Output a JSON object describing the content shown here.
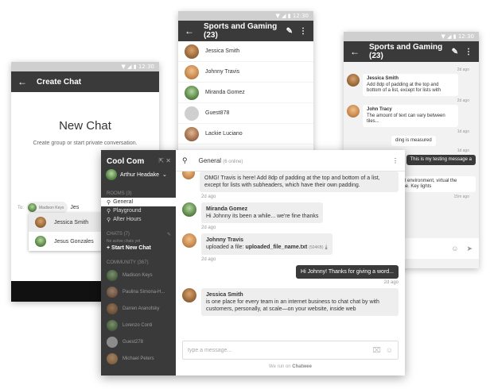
{
  "phone1": {
    "status_time": "12:30",
    "appbar_title": "Create Chat",
    "heading": "New Chat",
    "subheading": "Create group or start private conversation.",
    "to_label": "To:",
    "chip_name": "Madison Keys",
    "typed": "Jes",
    "suggestions": [
      {
        "name": "Jessica Smith",
        "selected": true
      },
      {
        "name": "Jesus Gonzales",
        "selected": false
      }
    ]
  },
  "phone2": {
    "status_time": "12:30",
    "appbar_title": "Sports and Gaming (23)",
    "members": [
      "Jessica Smith",
      "Johnny Travis",
      "Miranda Gomez",
      "Guest878",
      "Lackie Luciano"
    ]
  },
  "phone3": {
    "status_time": "12:30",
    "appbar_title": "Sports and Gaming (23)",
    "messages": [
      {
        "time": "2d ago",
        "author": "Jessica Smith",
        "text": "Add 8dp of padding at the top and bottom of a list, except for lists with"
      },
      {
        "time": "2d ago",
        "author": "John Tracy",
        "text": "The amount of text can vary between tiles..."
      },
      {
        "time": "1d ago",
        "text": "ding is measured"
      },
      {
        "time": "1d ago",
        "text": "This is my testing message a",
        "outgoing": true
      },
      {
        "time": "",
        "text": "rerial environment, virtual the scene. Key lights"
      }
    ],
    "last_time": "15m ago"
  },
  "desktop": {
    "brand": "Cool Com",
    "user": "Arthur Headake",
    "rooms_label": "ROOMS",
    "rooms_count": "(3)",
    "rooms": [
      "General",
      "Playground",
      "After Hours"
    ],
    "chats_label": "CHATS",
    "chats_count": "(7)",
    "no_chats": "No active chats yet",
    "start_chat": "+ Start New Chat",
    "community_label": "COMMUNITY",
    "community_count": "(367)",
    "community": [
      "Madison Keys",
      "Paulina Simona-H...",
      "Darren Aranofsky",
      "Lorenzo Conti",
      "Guest278",
      "Michael Peters"
    ],
    "room_title": "General",
    "room_online": "(6 online)",
    "feed": {
      "m1_text": "OMG! Travis is here! Add 8dp of padding at the top and bottom of a list, except for lists with subheaders, which have their own padding.",
      "m1_time": "2d ago",
      "m2_author": "Miranda Gomez",
      "m2_text": "Hi Johnny its been a while... we're fine thanks",
      "m2_time": "2d ago",
      "m3_author": "Johnny Travis",
      "m3_text": "uploaded a file:",
      "m3_file": "uploaded_file_name.txt",
      "m3_size": "(504KB)",
      "m3_time": "2d ago",
      "m4_text": "Hi Johnny! Thanks for giving a word...",
      "m4_time": "2d ago",
      "m5_author": "Jessica Smith",
      "m5_text": "is one place for every team in an internet business to chat chat by with customers, personally, at scale—on your website, inside web"
    },
    "composer_placeholder": "type a message...",
    "footer_prefix": "We run on",
    "footer_brand": "Chatwee"
  }
}
